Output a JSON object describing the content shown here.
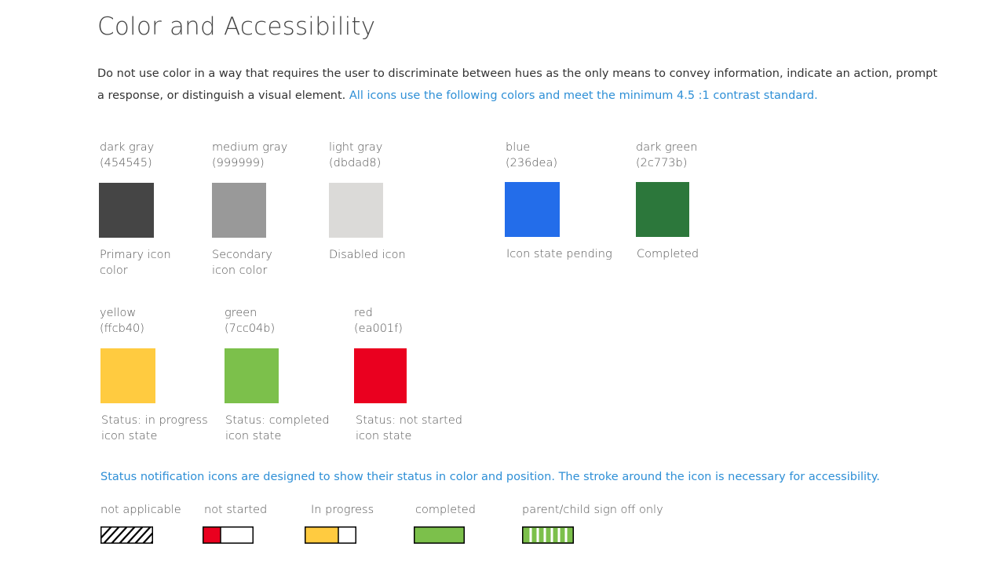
{
  "page": {
    "title": "Color and Accessibility",
    "intro_text": "Do not use color in a way that requires the user to discriminate between hues as the only means to convey information, indicate an action, prompt a response, or distinguish a visual element. ",
    "intro_accent": "All icons use the following colors and meet the minimum 4.5 :1 contrast standard."
  },
  "swatches": {
    "dark_gray": {
      "name": "dark gray",
      "hex_label": "(454545)",
      "color": "#454545",
      "desc": "Primary icon\ncolor"
    },
    "medium_gray": {
      "name": "medium gray",
      "hex_label": "(999999)",
      "color": "#999999",
      "desc": "Secondary\nicon color"
    },
    "light_gray": {
      "name": "light gray",
      "hex_label": "(dbdad8)",
      "color": "#dbdad8",
      "desc": "Disabled icon"
    },
    "blue": {
      "name": "blue",
      "hex_label": "(236dea)",
      "color": "#236dea",
      "desc": "Icon state pending"
    },
    "dark_green": {
      "name": "dark green",
      "hex_label": "(2c773b)",
      "color": "#2c773b",
      "desc": "Completed"
    },
    "yellow": {
      "name": "yellow",
      "hex_label": "(ffcb40)",
      "color": "#ffcb40",
      "desc": "Status: in progress\nicon state"
    },
    "green": {
      "name": "green",
      "hex_label": "(7cc04b)",
      "color": "#7cc04b",
      "desc": "Status: completed\nicon state"
    },
    "red": {
      "name": "red",
      "hex_label": "(ea001f)",
      "color": "#ea001f",
      "desc": "Status: not started\nicon state"
    }
  },
  "status": {
    "note": "Status notification icons are designed to show their status in color and position. The stroke around the icon is necessary for accessibility.",
    "not_applicable": "not applicable",
    "not_started": "not started",
    "in_progress": "In progress",
    "completed": "completed",
    "parent_child": "parent/child sign off only"
  }
}
